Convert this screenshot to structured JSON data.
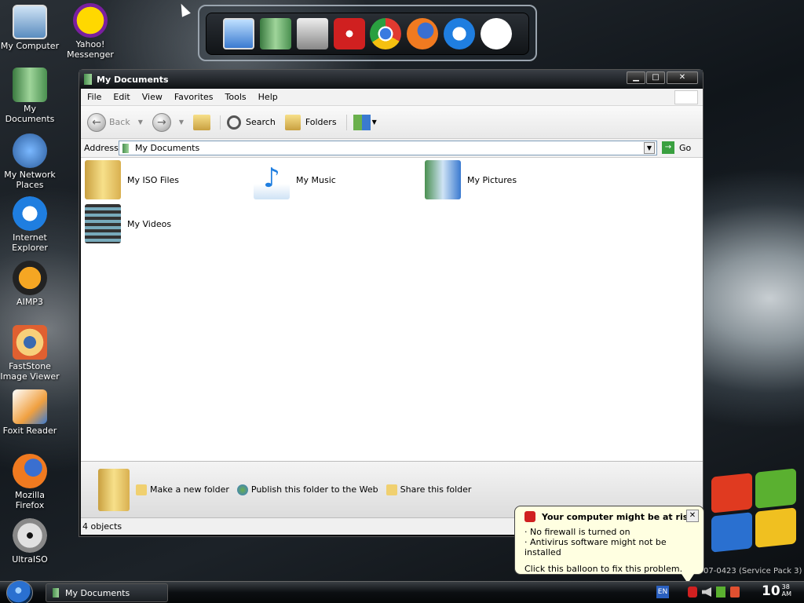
{
  "desktop_icons": [
    {
      "label": "My Computer",
      "icon": "computer-icon"
    },
    {
      "label": "My Documents",
      "icon": "documents-icon"
    },
    {
      "label": "My Network Places",
      "icon": "network-icon"
    },
    {
      "label": "Internet Explorer",
      "icon": "ie-icon"
    },
    {
      "label": "AIMP3",
      "icon": "aimp-icon"
    },
    {
      "label": "FastStone Image Viewer",
      "icon": "faststone-icon"
    },
    {
      "label": "Foxit Reader",
      "icon": "foxit-icon"
    },
    {
      "label": "Mozilla Firefox",
      "icon": "firefox-icon"
    },
    {
      "label": "UltraISO",
      "icon": "ultraiso-icon"
    },
    {
      "label": "Yahoo! Messenger",
      "icon": "yahoo-icon"
    }
  ],
  "window": {
    "title": "My Documents",
    "buttons": {
      "minimize": "▁",
      "maximize": "□",
      "close": "✕"
    },
    "menu": [
      "File",
      "Edit",
      "View",
      "Favorites",
      "Tools",
      "Help"
    ],
    "toolbar": {
      "back": "Back",
      "search": "Search",
      "folders": "Folders"
    },
    "address": {
      "label": "Address",
      "value": "My Documents",
      "go": "Go"
    },
    "items": [
      {
        "label": "My ISO Files",
        "icon": "folder-icon"
      },
      {
        "label": "My Music",
        "icon": "music-icon"
      },
      {
        "label": "My Pictures",
        "icon": "pictures-icon"
      },
      {
        "label": "My Videos",
        "icon": "videos-icon"
      }
    ],
    "tasks": [
      "Make a new folder",
      "Publish this folder to the Web",
      "Share this folder"
    ],
    "status": "4 objects"
  },
  "balloon": {
    "title": "Your computer might be at risk",
    "lines": [
      "No firewall is turned on",
      "Antivirus software might not be installed"
    ],
    "footer": "Click this balloon to fix this problem.",
    "close": "✕"
  },
  "taskbar": {
    "task": "My Documents",
    "lang": "EN",
    "time_hour": "10",
    "time_min": "38",
    "time_ampm": "AM"
  },
  "watermark": "07-0423 (Service Pack 3)"
}
